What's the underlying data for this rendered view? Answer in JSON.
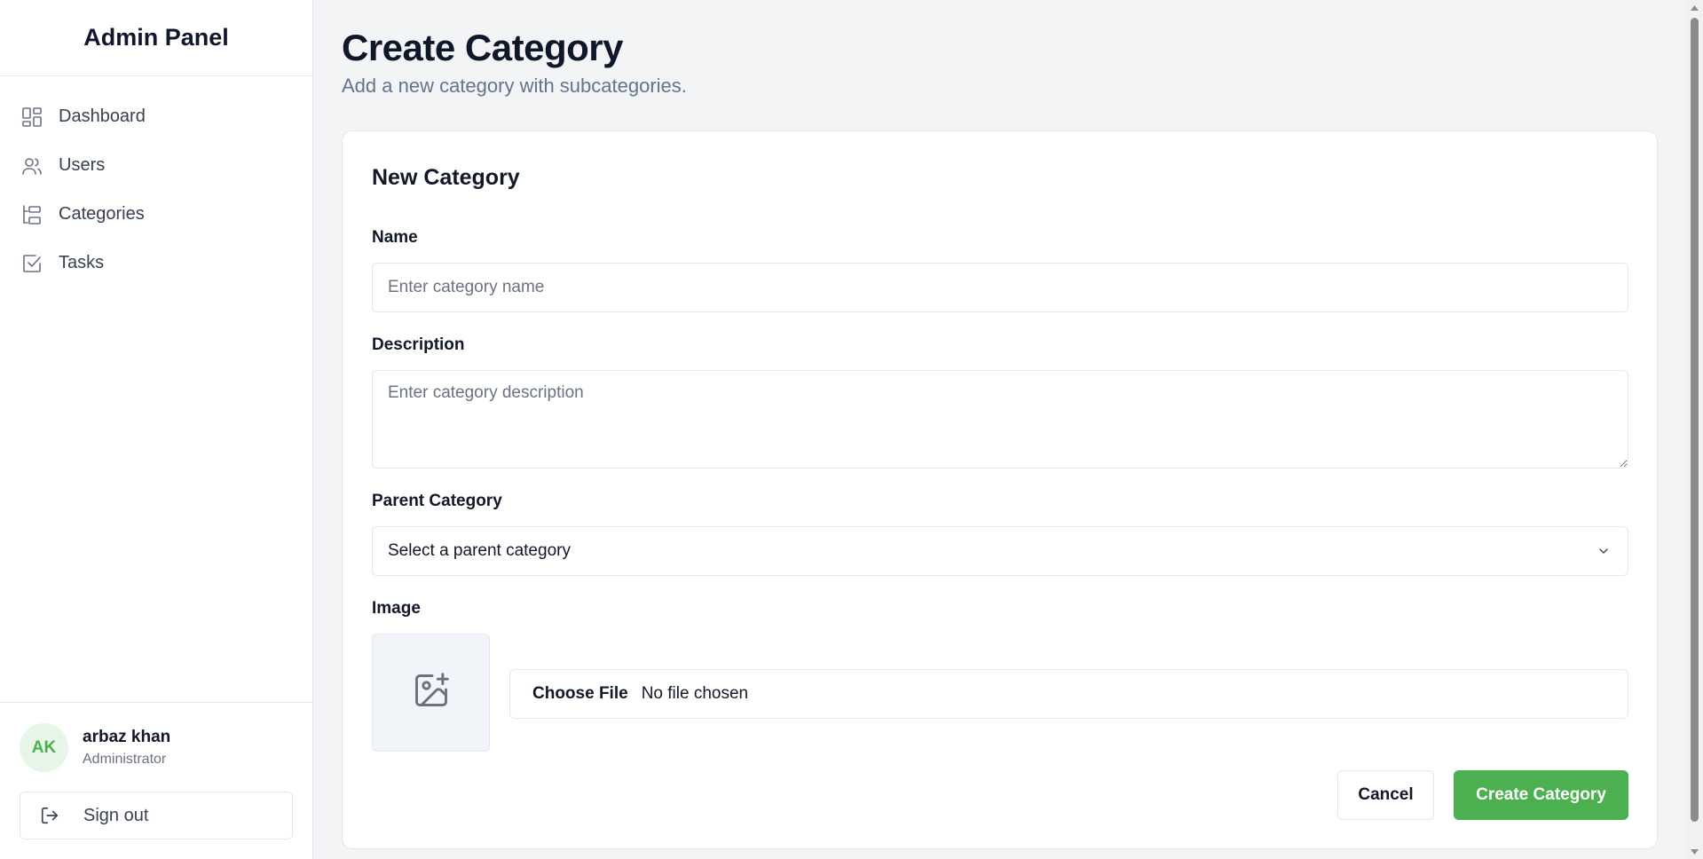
{
  "sidebar": {
    "brand": "Admin Panel",
    "items": [
      {
        "label": "Dashboard",
        "icon": "dashboard-icon"
      },
      {
        "label": "Users",
        "icon": "users-icon"
      },
      {
        "label": "Categories",
        "icon": "categories-icon"
      },
      {
        "label": "Tasks",
        "icon": "tasks-icon"
      }
    ],
    "user": {
      "initials": "AK",
      "name": "arbaz khan",
      "role": "Administrator"
    },
    "signout_label": "Sign out"
  },
  "header": {
    "title": "Create Category",
    "subtitle": "Add a new category with subcategories."
  },
  "form": {
    "title": "New Category",
    "name": {
      "label": "Name",
      "placeholder": "Enter category name",
      "value": ""
    },
    "description": {
      "label": "Description",
      "placeholder": "Enter category description",
      "value": ""
    },
    "parent": {
      "label": "Parent Category",
      "selected": "Select a parent category"
    },
    "image": {
      "label": "Image",
      "choose_label": "Choose File",
      "status": "No file chosen"
    },
    "cancel_label": "Cancel",
    "submit_label": "Create Category"
  },
  "colors": {
    "accent": "#4caf50",
    "avatar_bg": "#e8f5e9",
    "background": "#f3f4f6"
  }
}
